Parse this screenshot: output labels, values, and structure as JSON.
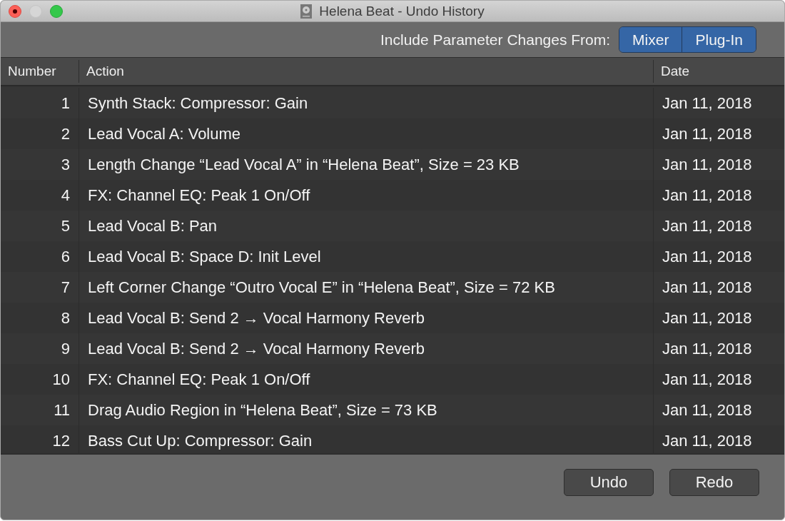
{
  "window": {
    "title": "Helena Beat - Undo History"
  },
  "toolbar": {
    "label": "Include Parameter Changes From:",
    "toggles": [
      {
        "label": "Mixer",
        "selected": true
      },
      {
        "label": "Plug-In",
        "selected": true
      }
    ]
  },
  "table": {
    "columns": [
      "Number",
      "Action",
      "Date"
    ],
    "rows": [
      {
        "number": "1",
        "action": "Synth Stack: Compressor: Gain",
        "date": "Jan 11, 2018"
      },
      {
        "number": "2",
        "action": "Lead Vocal A: Volume",
        "date": "Jan 11, 2018"
      },
      {
        "number": "3",
        "action": "Length Change “Lead Vocal A” in “Helena Beat”, Size = 23 KB",
        "date": "Jan 11, 2018"
      },
      {
        "number": "4",
        "action": "FX: Channel EQ: Peak 1 On/Off",
        "date": "Jan 11, 2018"
      },
      {
        "number": "5",
        "action": "Lead Vocal B: Pan",
        "date": "Jan 11, 2018"
      },
      {
        "number": "6",
        "action": "Lead Vocal B: Space D: Init Level",
        "date": "Jan 11, 2018"
      },
      {
        "number": "7",
        "action": "Left Corner Change “Outro Vocal E” in “Helena Beat”, Size = 72 KB",
        "date": "Jan 11, 2018"
      },
      {
        "number": "8",
        "action": "Lead Vocal B: Send 2 → Vocal Harmony Reverb",
        "date": "Jan 11, 2018"
      },
      {
        "number": "9",
        "action": "Lead Vocal B: Send 2 → Vocal Harmony Reverb",
        "date": "Jan 11, 2018"
      },
      {
        "number": "10",
        "action": "FX: Channel EQ: Peak 1 On/Off",
        "date": "Jan 11, 2018"
      },
      {
        "number": "11",
        "action": "Drag Audio Region in “Helena Beat”, Size = 73 KB",
        "date": "Jan 11, 2018"
      },
      {
        "number": "12",
        "action": "Bass Cut Up: Compressor: Gain",
        "date": "Jan 11, 2018"
      }
    ]
  },
  "buttons": [
    "Undo",
    "Redo"
  ]
}
